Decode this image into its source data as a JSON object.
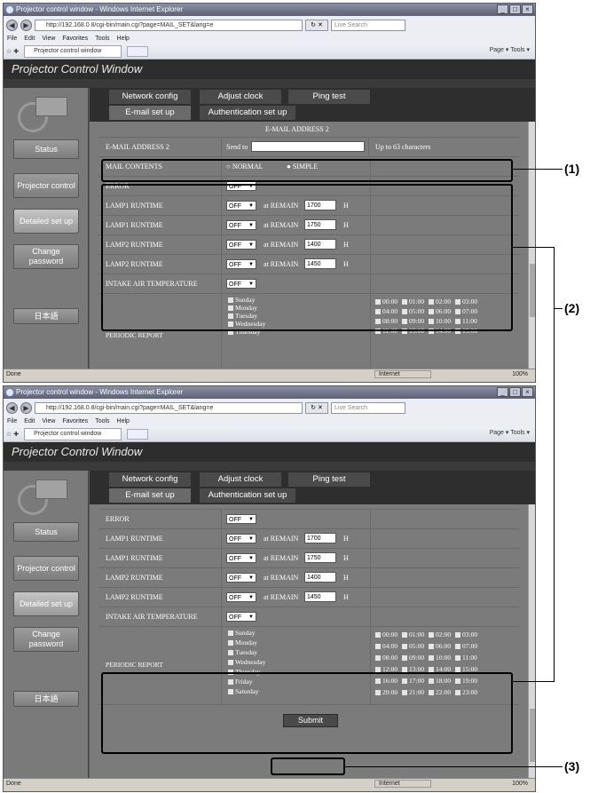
{
  "browser": {
    "title": "Projector control window - Windows Internet Explorer",
    "url1": "http://192.168.0.8/cgi-bin/main.cgi?page=MAIL_SET&lang=e",
    "url2": "http://192.168.0.8/cgi-bin/main.cgi?page=MAIL_SET&lang=e",
    "search_placeholder": "Live Search",
    "menu": [
      "File",
      "Edit",
      "View",
      "Favorites",
      "Tools",
      "Help"
    ],
    "fav_tab": "Projector control window",
    "cmd": "Page ▾  Tools ▾",
    "status_left": "Done",
    "zone": "Internet",
    "zoom": "100%"
  },
  "app": {
    "title": "Projector Control Window",
    "sidebar": [
      "Status",
      "Projector control",
      "Detailed set up",
      "Change password",
      "日本語"
    ],
    "tabs": [
      "Network config",
      "Adjust clock",
      "Ping test",
      "E-mail set up",
      "Authentication set up"
    ]
  },
  "form": {
    "header": "E-MAIL ADDRESS 2",
    "email_label": "E-MAIL ADDRESS 2",
    "send_to": "Send to",
    "up_to": "Up to 63 characters",
    "mail_contents": "MAIL CONTENTS",
    "normal": "NORMAL",
    "simple": "SIMPLE",
    "error": "ERROR",
    "lamp1": "LAMP1 RUNTIME",
    "lamp2": "LAMP2 RUNTIME",
    "intake": "INTAKE AIR TEMPERATURE",
    "periodic": "PERIODIC REPORT",
    "off": "OFF",
    "at_remain": "at REMAIN",
    "h": "H",
    "v1700": "1700",
    "v1750": "1750",
    "v1400": "1400",
    "v1450": "1450",
    "days": [
      "Sunday",
      "Monday",
      "Tuesday",
      "Wednesday",
      "Thursday",
      "Friday",
      "Saturday"
    ],
    "hours": [
      "00:00",
      "01:00",
      "02:00",
      "03:00",
      "04:00",
      "05:00",
      "06:00",
      "07:00",
      "08:00",
      "09:00",
      "10:00",
      "11:00",
      "12:00",
      "13:00",
      "14:00",
      "15:00",
      "16:00",
      "17:00",
      "18:00",
      "19:00",
      "20:00",
      "21:00",
      "22:00",
      "23:00"
    ],
    "submit": "Submit"
  },
  "callouts": [
    "(1)",
    "(2)",
    "(3)"
  ]
}
